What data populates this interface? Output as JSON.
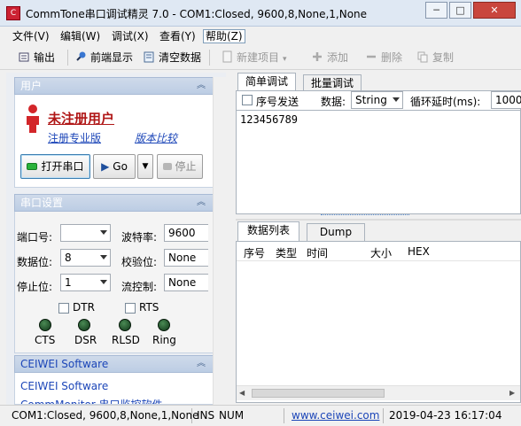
{
  "window": {
    "icon_label": "C",
    "title": "CommTone串口调试精灵 7.0 - COM1:Closed, 9600,8,None,1,None",
    "minimize": "─",
    "maximize": "□",
    "close": "✕"
  },
  "menu": [
    "文件(V)",
    "编辑(W)",
    "调试(X)",
    "查看(Y)",
    "帮助(Z)"
  ],
  "toolbar": {
    "output": "输出",
    "foreground": "前端显示",
    "clear": "清空数据",
    "new_item": "新建项目",
    "add": "添加",
    "delete": "删除",
    "copy": "复制"
  },
  "user_section": {
    "header": "用户",
    "status": "未注册用户",
    "register_link": "注册专业版",
    "compare_link": "版本比较",
    "open_port": "打开串口",
    "go": "Go",
    "stop": "停止"
  },
  "port_section": {
    "header": "串口设置",
    "port_label": "端口号:",
    "port_value": "",
    "baud_label": "波特率:",
    "baud_value": "9600",
    "databits_label": "数据位:",
    "databits_value": "8",
    "parity_label": "校验位:",
    "parity_value": "None",
    "stopbits_label": "停止位:",
    "stopbits_value": "1",
    "flow_label": "流控制:",
    "flow_value": "None",
    "dtr": "DTR",
    "rts": "RTS",
    "leds": [
      "CTS",
      "DSR",
      "RLSD",
      "Ring"
    ]
  },
  "ceiwei_section": {
    "header": "CEIWEI Software",
    "link1": "CEIWEI Software",
    "link2": "CommMonitor 串口监控软件"
  },
  "top_tabs": {
    "simple": "简单调试",
    "batch": "批量调试",
    "hex_send": "序号发送",
    "data_label": "数据:",
    "data_type": "String",
    "delay_label": "循环延时(ms):",
    "delay_value": "1000",
    "send_text": "123456789"
  },
  "bottom_tabs": {
    "list": "数据列表",
    "dump": "Dump",
    "columns": [
      "序号",
      "类型",
      "时间",
      "大小",
      "HEX"
    ]
  },
  "statusbar": {
    "port": "COM1:Closed, 9600,8,None,1,None",
    "ins": "INS",
    "num": "NUM",
    "site": "www.ceiwei.com",
    "datetime": "2019-04-23 16:17:04"
  },
  "colors": {
    "accent": "#1f4f9c",
    "unregistered": "#b01717",
    "link": "#1c46b8"
  }
}
